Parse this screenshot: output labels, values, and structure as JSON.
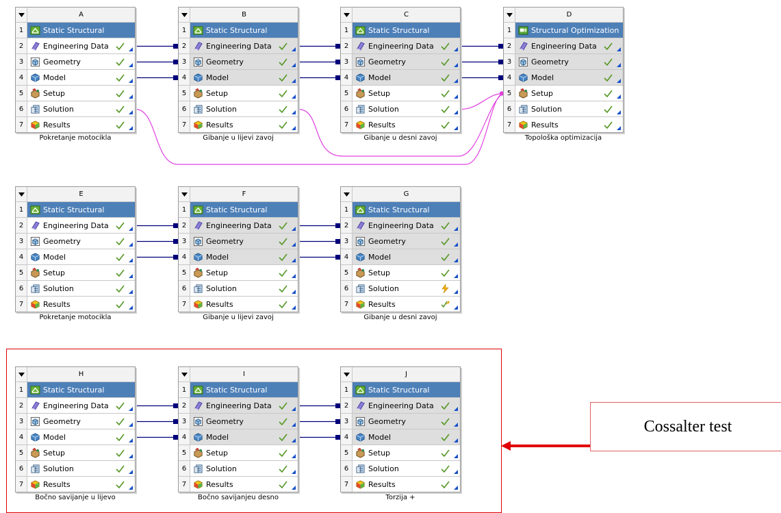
{
  "row_labels": [
    "Engineering Data",
    "Geometry",
    "Model",
    "Setup",
    "Solution",
    "Results"
  ],
  "row_numbers": [
    "1",
    "2",
    "3",
    "4",
    "5",
    "6",
    "7"
  ],
  "systems": [
    {
      "id": "A",
      "title": "Static Structural",
      "title_icon": "static-structural-icon",
      "caption": "Pokretanje motocikla",
      "status": [
        "check",
        "check",
        "check",
        "check",
        "check",
        "check"
      ]
    },
    {
      "id": "B",
      "title": "Static Structural",
      "title_icon": "static-structural-icon",
      "caption": "Gibanje u lijevi zavoj",
      "status": [
        "check",
        "check",
        "check",
        "check",
        "check",
        "check"
      ]
    },
    {
      "id": "C",
      "title": "Static Structural",
      "title_icon": "static-structural-icon",
      "caption": "Gibanje u desni zavoj",
      "status": [
        "check",
        "check",
        "check",
        "check",
        "check",
        "check"
      ]
    },
    {
      "id": "D",
      "title": "Structural Optimization",
      "title_icon": "structural-optimization-icon",
      "caption": "Topološka optimizacija",
      "status": [
        "check",
        "check",
        "check",
        "check",
        "check",
        "check"
      ]
    },
    {
      "id": "E",
      "title": "Static Structural",
      "title_icon": "static-structural-icon",
      "caption": "Pokretanje motocikla",
      "status": [
        "check",
        "check",
        "check",
        "check",
        "check",
        "check"
      ]
    },
    {
      "id": "F",
      "title": "Static Structural",
      "title_icon": "static-structural-icon",
      "caption": "Gibanje u lijevi zavoj",
      "status": [
        "check",
        "check",
        "check",
        "check",
        "check",
        "check"
      ]
    },
    {
      "id": "G",
      "title": "Static Structural",
      "title_icon": "static-structural-icon",
      "caption": "Gibanje u desni zavoj",
      "status": [
        "check",
        "check",
        "check",
        "check",
        "refresh",
        "update"
      ]
    },
    {
      "id": "H",
      "title": "Static Structural",
      "title_icon": "static-structural-icon",
      "caption": "Bočno savijanje u lijevo",
      "status": [
        "check",
        "check",
        "check",
        "check",
        "check",
        "check"
      ]
    },
    {
      "id": "I",
      "title": "Static Structural",
      "title_icon": "static-structural-icon",
      "caption": "Bočno savijanjeu desno",
      "status": [
        "check",
        "check",
        "check",
        "check",
        "check",
        "check"
      ]
    },
    {
      "id": "J",
      "title": "Static Structural",
      "title_icon": "static-structural-icon",
      "caption": "Torzija +",
      "status": [
        "check",
        "check",
        "check",
        "check",
        "check",
        "check"
      ]
    }
  ],
  "callout": {
    "text": "Cossalter test"
  },
  "colors": {
    "title_bar": "#4e80b8",
    "shared_row": "#dedede",
    "link_line": "#00007a",
    "solution_link": "#e040e0",
    "frame": "#e00000",
    "check": "#5a9a2c"
  }
}
